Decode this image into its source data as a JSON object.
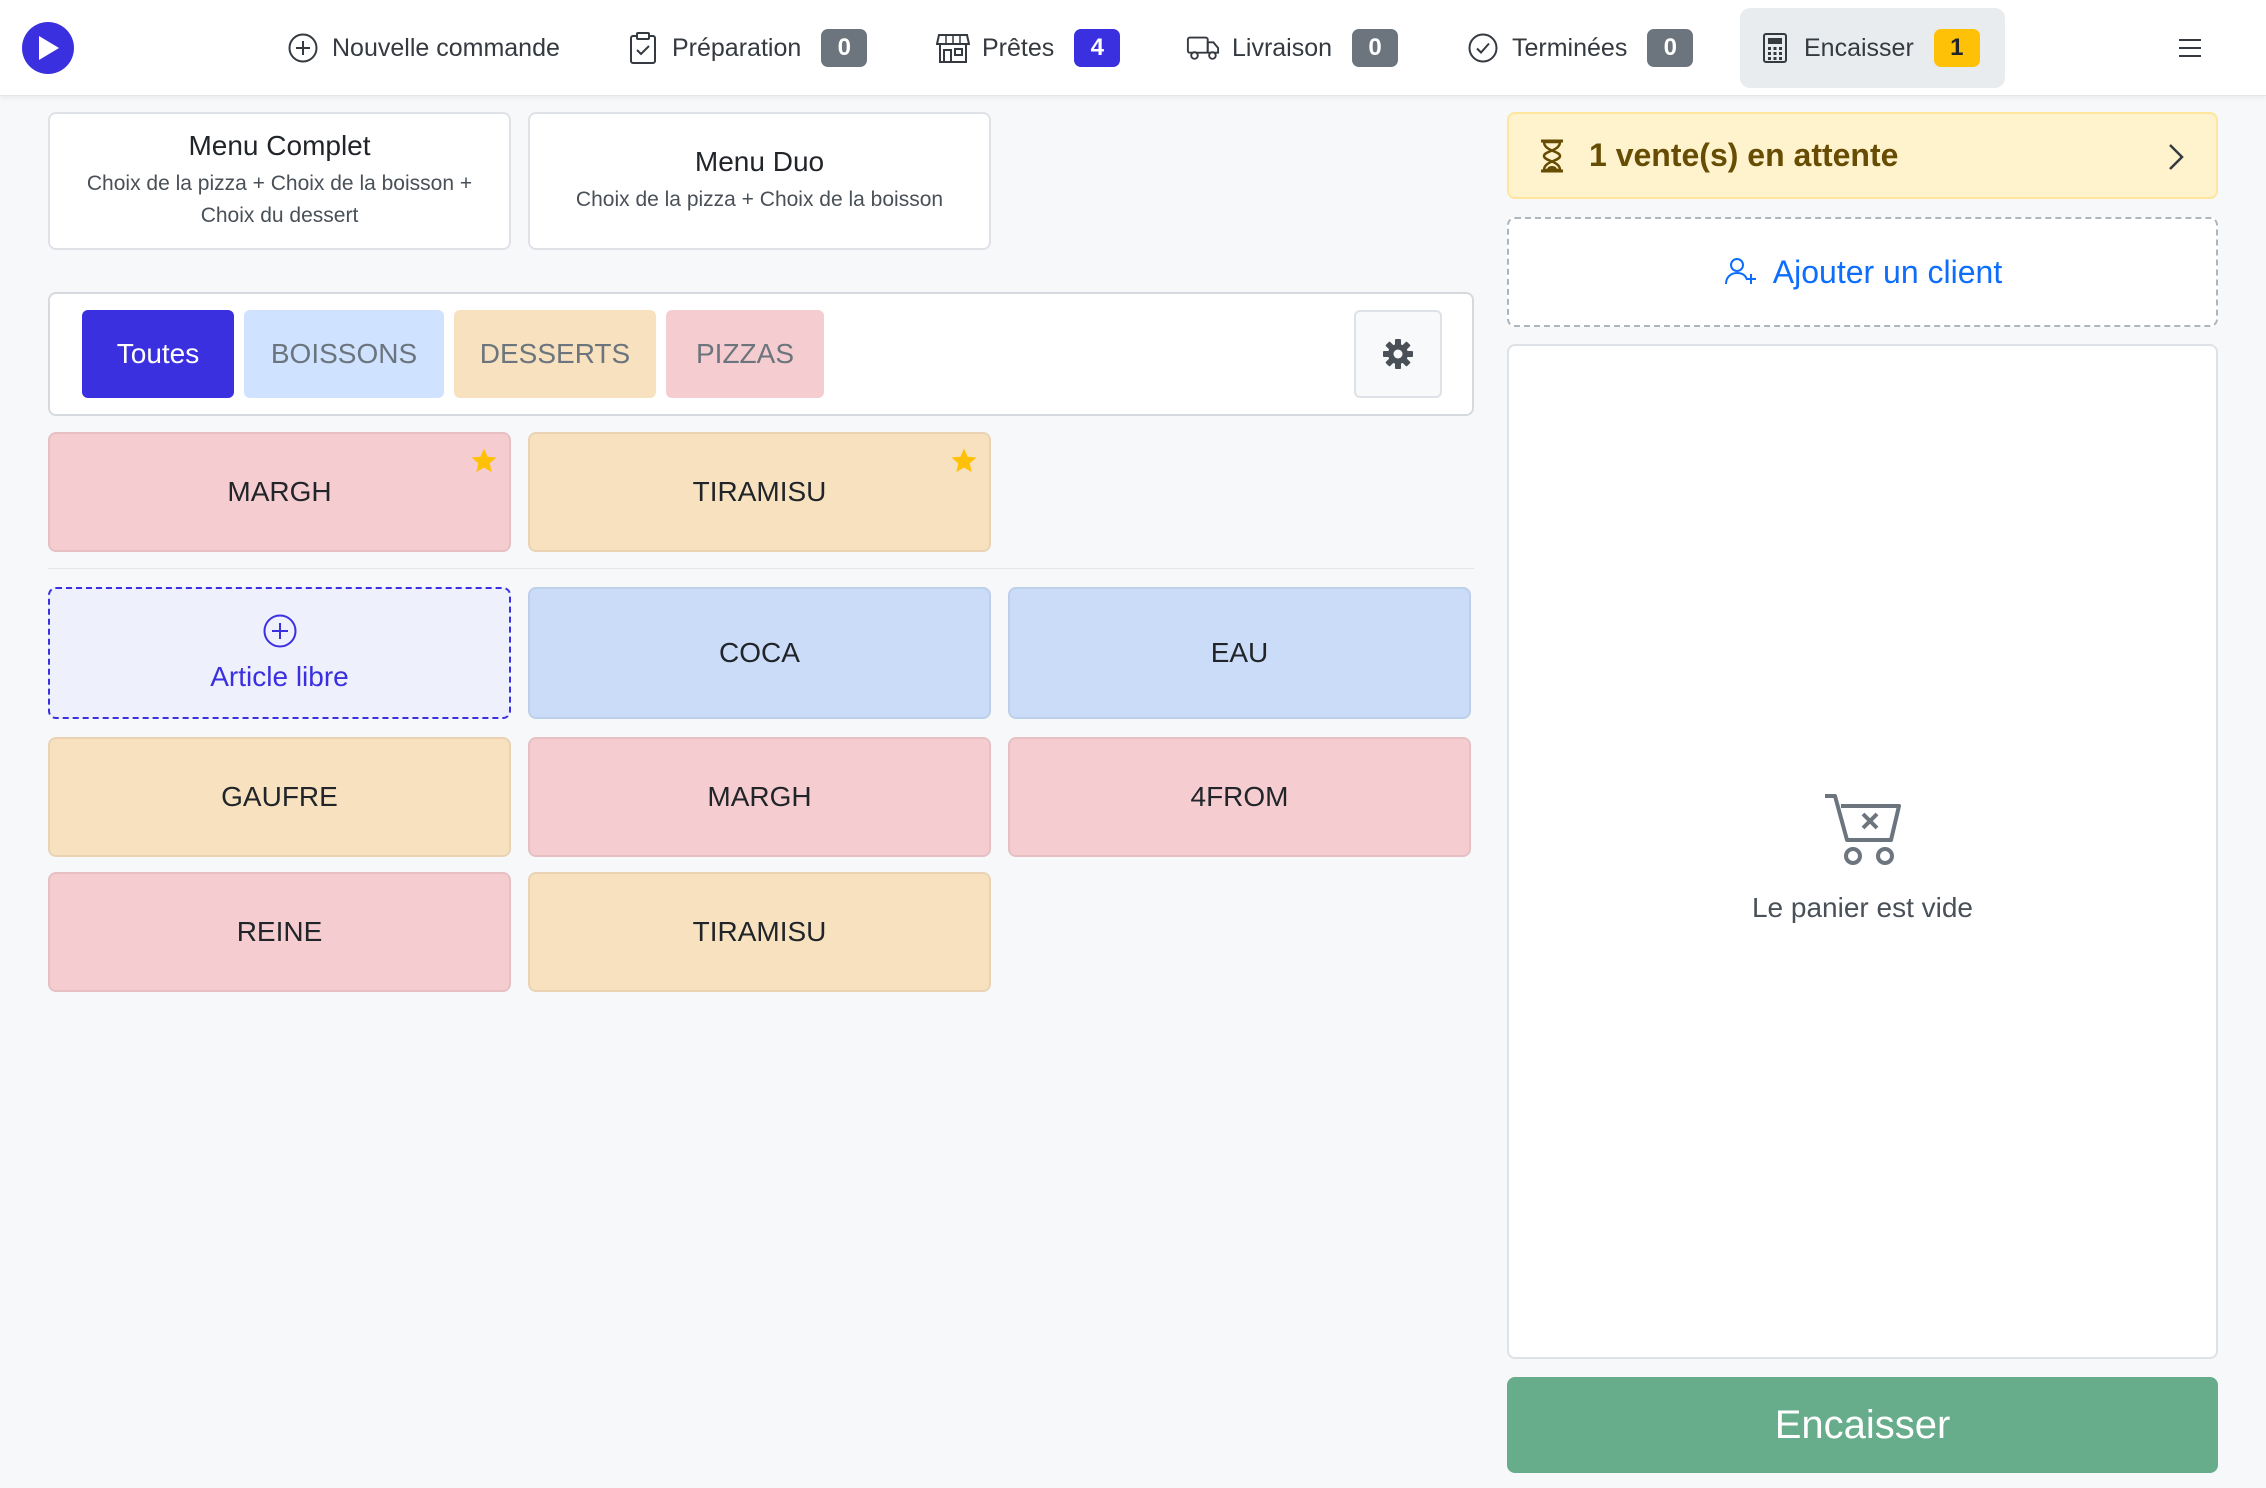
{
  "nav": {
    "items": [
      {
        "label": "Nouvelle commande",
        "icon": "plus-circle-icon"
      },
      {
        "label": "Préparation",
        "icon": "clipboard-icon",
        "badge": "0",
        "badge_color": "#6c757d"
      },
      {
        "label": "Prêtes",
        "icon": "shop-icon",
        "badge": "4",
        "badge_color": "#3b30e0"
      },
      {
        "label": "Livraison",
        "icon": "truck-icon",
        "badge": "0",
        "badge_color": "#6c757d"
      },
      {
        "label": "Terminées",
        "icon": "check-circle-icon",
        "badge": "0",
        "badge_color": "#6c757d"
      },
      {
        "label": "Encaisser",
        "icon": "calculator-icon",
        "badge": "1",
        "badge_color": "#ffc107",
        "active": true
      }
    ]
  },
  "menus": [
    {
      "title": "Menu Complet",
      "description": "Choix de la pizza + Choix de la boisson + Choix du dessert"
    },
    {
      "title": "Menu Duo",
      "description": "Choix de la pizza + Choix de la boisson"
    }
  ],
  "filters": [
    {
      "label": "Toutes",
      "active": true,
      "bg": "#3b30e0",
      "color": "#ffffff"
    },
    {
      "label": "BOISSONS",
      "bg": "#cfe2ff",
      "color": "#6c757d"
    },
    {
      "label": "DESSERTS",
      "bg": "#f8e1bf",
      "color": "#6c757d"
    },
    {
      "label": "PIZZAS",
      "bg": "#f5cdd0",
      "color": "#6c757d"
    }
  ],
  "favorites": [
    {
      "label": "MARGH",
      "bg": "#f5cdd0"
    },
    {
      "label": "TIRAMISU",
      "bg": "#f8e1bf"
    }
  ],
  "free_article": {
    "label": "Article libre"
  },
  "products": [
    {
      "label": "COCA",
      "bg": "#cadcf8"
    },
    {
      "label": "EAU",
      "bg": "#cadcf8"
    },
    {
      "label": "GAUFRE",
      "bg": "#f8e1bf"
    },
    {
      "label": "MARGH",
      "bg": "#f5cdd0"
    },
    {
      "label": "4FROM",
      "bg": "#f5cdd0"
    },
    {
      "label": "REINE",
      "bg": "#f5cdd0"
    },
    {
      "label": "TIRAMISU",
      "bg": "#f8e1bf"
    }
  ],
  "pending": {
    "label": "1 vente(s) en attente"
  },
  "client": {
    "label": "Ajouter un client"
  },
  "cart": {
    "empty_text": "Le panier est vide"
  },
  "checkout": {
    "label": "Encaisser"
  },
  "colors": {
    "accent": "#3b30e0",
    "star": "#ffc107",
    "checkout": "#67ad8c"
  }
}
